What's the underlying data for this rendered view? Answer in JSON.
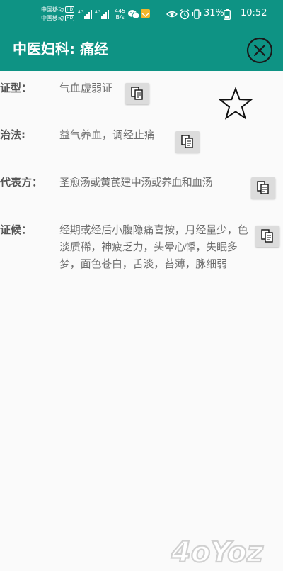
{
  "status_bar": {
    "carrier1": "中国移动",
    "carrier2": "中国移动",
    "hd_badge": "HD",
    "net_speed_value": "445",
    "net_speed_unit": "B/s",
    "battery_percent": "31%",
    "time": "10:52"
  },
  "toolbar": {
    "title": "中医妇科: 痛经"
  },
  "rows": [
    {
      "label": "证型：",
      "value": "气血虚弱证"
    },
    {
      "label": "治法:",
      "value": "益气养血，调经止痛"
    },
    {
      "label": "代表方：",
      "value": "圣愈汤或黄芪建中汤或养血和血汤"
    },
    {
      "label": "证候：",
      "value": "经期或经后小腹隐痛喜按，月经量少，色淡质稀，神疲乏力，头晕心悸，失眠多梦，面色苍白，舌淡，苔薄，脉细弱"
    }
  ],
  "colors": {
    "header": "#0e9384",
    "label_text": "#555555",
    "value_text": "#6f6f6f",
    "copy_button": "#dcdcdc"
  },
  "watermark": "4oYoz"
}
